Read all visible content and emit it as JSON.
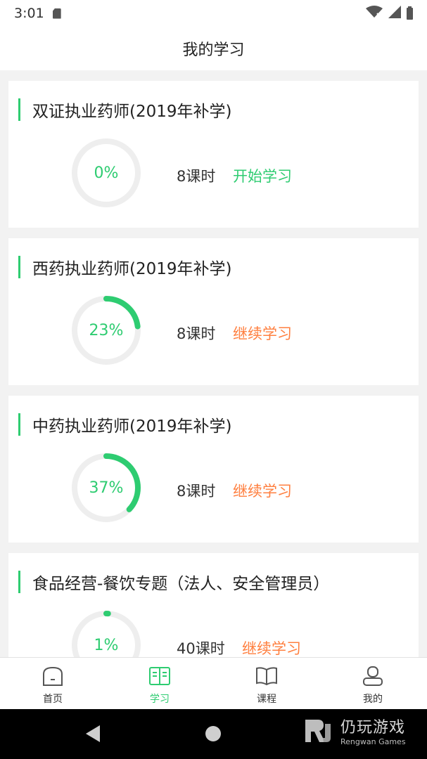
{
  "status_bar": {
    "time": "3:01",
    "icons": [
      "sd-card-icon",
      "wifi-icon",
      "signal-icon",
      "battery-icon"
    ]
  },
  "header": {
    "title": "我的学习"
  },
  "courses": [
    {
      "title": "双证执业药师(2019年补学)",
      "progress_percent": 0,
      "progress_label": "0%",
      "hours": "8课时",
      "action": "开始学习",
      "action_color": "#2ecc71"
    },
    {
      "title": "西药执业药师(2019年补学)",
      "progress_percent": 23,
      "progress_label": "23%",
      "hours": "8课时",
      "action": "继续学习",
      "action_color": "#ff7f3f"
    },
    {
      "title": "中药执业药师(2019年补学)",
      "progress_percent": 37,
      "progress_label": "37%",
      "hours": "8课时",
      "action": "继续学习",
      "action_color": "#ff7f3f"
    },
    {
      "title": "食品经营-餐饮专题（法人、安全管理员）",
      "progress_percent": 1,
      "progress_label": "1%",
      "hours": "40课时",
      "action": "继续学习",
      "action_color": "#ff7f3f"
    }
  ],
  "tabs": [
    {
      "label": "首页",
      "icon": "home-icon",
      "active": false
    },
    {
      "label": "学习",
      "icon": "study-book-icon",
      "active": true
    },
    {
      "label": "课程",
      "icon": "course-book-icon",
      "active": false
    },
    {
      "label": "我的",
      "icon": "profile-icon",
      "active": false
    }
  ],
  "colors": {
    "accent": "#2ecc71",
    "continue": "#ff7f3f",
    "ring_track": "#eeeeee"
  },
  "watermark": {
    "cn": "仍玩游戏",
    "en": "Rengwan Games"
  }
}
